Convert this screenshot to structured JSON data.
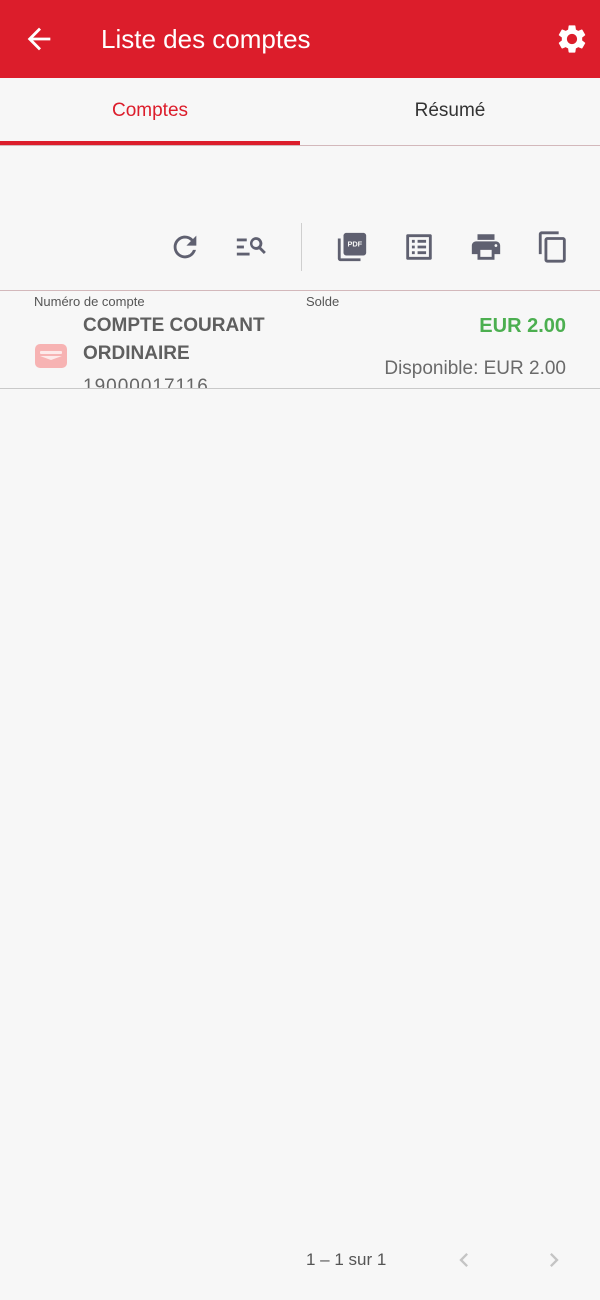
{
  "appbar": {
    "title": "Liste des comptes",
    "back_icon": "arrow-left-icon",
    "settings_icon": "gear-icon",
    "color": "#dc1d2b"
  },
  "tabs": [
    {
      "label": "Comptes",
      "active": true
    },
    {
      "label": "Résumé",
      "active": false
    }
  ],
  "toolbar": {
    "icons": [
      "refresh-icon",
      "filter-search-icon",
      "pdf-icon",
      "list-detail-icon",
      "print-icon",
      "copy-icon"
    ]
  },
  "table": {
    "headers": {
      "account_number": "Numéro de compte",
      "balance": "Solde"
    },
    "rows": [
      {
        "name": "COMPTE COURANT ORDINAIRE",
        "number": "19000017116",
        "balance": "EUR 2.00",
        "available": "Disponible: EUR 2.00",
        "icon": "card-icon"
      }
    ]
  },
  "pagination": {
    "text": "1 – 1 sur 1",
    "prev_icon": "chevron-left-icon",
    "next_icon": "chevron-right-icon"
  },
  "colors": {
    "accent": "#dc1d2b",
    "positive": "#4caf50",
    "icon_gray": "#6b6b7a"
  }
}
